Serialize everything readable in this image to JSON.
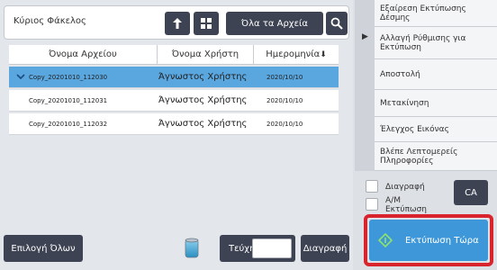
{
  "header": {
    "folder_title": "Κύριος Φάκελος",
    "all_files_label": "Όλα τα Αρχεία"
  },
  "table": {
    "columns": [
      "Όνομα Αρχείου",
      "Όνομα Χρήστη",
      "Ημερομηνία"
    ],
    "sort_indicator": "⬇",
    "rows": [
      {
        "name": "Copy_20201010_112030",
        "user": "Άγνωστος Χρήστης",
        "date": "2020/10/10",
        "selected": true
      },
      {
        "name": "Copy_20201010_112031",
        "user": "Άγνωστος Χρήστης",
        "date": "2020/10/10",
        "selected": false
      },
      {
        "name": "Copy_20201010_112032",
        "user": "Άγνωστος Χρήστης",
        "date": "2020/10/10",
        "selected": false
      }
    ]
  },
  "bottom": {
    "select_all_label": "Επιλογή Όλων",
    "copies_label": "Τεύχη",
    "copies_value": "",
    "delete_label": "Διαγραφή"
  },
  "menu": {
    "items": [
      "Εξαίρεση Εκτύπωσης Δέσμης",
      "Αλλαγή Ρύθμισης για Εκτύπωση",
      "Αποστολή",
      "Μετακίνηση",
      "Έλεγχος Εικόνας",
      "Βλέπε Λεπτομερείς Πληροφορίες"
    ]
  },
  "options": {
    "delete_label": "Διαγραφή",
    "bw_print_label": "Α/Μ Εκτύπωση",
    "ca_label": "CA"
  },
  "print_now_label": "Εκτύπωση Τώρα",
  "colors": {
    "dark_button": "#3d4352",
    "selected_row": "#5aa7e0",
    "print_button": "#3d97d8",
    "highlight_frame": "#d9232d"
  },
  "icons": {
    "up": "up-arrow-icon",
    "grid": "grid-view-icon",
    "search": "search-icon",
    "trash": "trash-bin-icon",
    "print": "print-start-icon",
    "panel_toggle": "panel-toggle-icon"
  }
}
